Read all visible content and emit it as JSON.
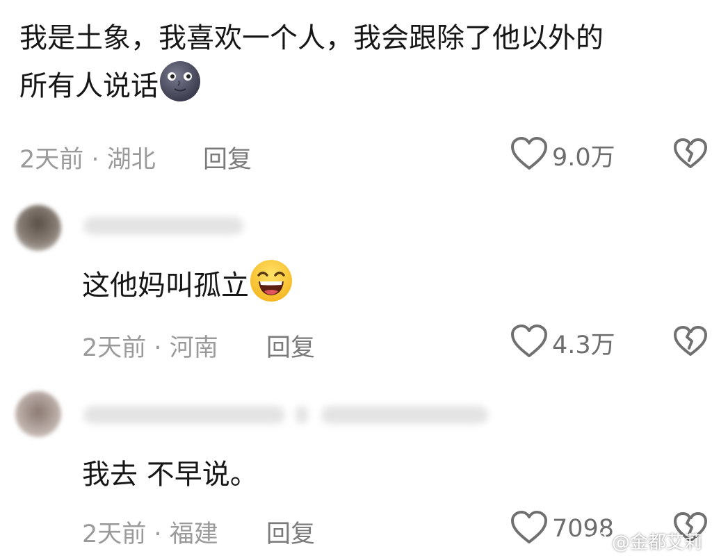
{
  "comments": [
    {
      "text_line1": "我是土象，我喜欢一个人，我会跟除了他以外的",
      "text_line2": "所有人说话",
      "emoji": "new-moon-face-emoji",
      "time": "2天前",
      "location": "湖北",
      "reply_label": "回复",
      "likes": "9.0万"
    },
    {
      "text": "这他妈叫孤立",
      "emoji": "grinning-smiling-eyes-emoji",
      "time": "2天前",
      "location": "河南",
      "reply_label": "回复",
      "likes": "4.3万"
    },
    {
      "text": "我去 不早说。",
      "time": "2天前",
      "location": "福建",
      "reply_label": "回复",
      "likes": "7098"
    }
  ],
  "separator": "·",
  "watermark": "@金都艾莉",
  "icons": {
    "like": "heart-outline-icon",
    "dislike": "broken-heart-icon",
    "watermark": "weibo-icon"
  },
  "colors": {
    "text": "#161616",
    "meta": "#9a9a9a",
    "icon": "#707070"
  }
}
